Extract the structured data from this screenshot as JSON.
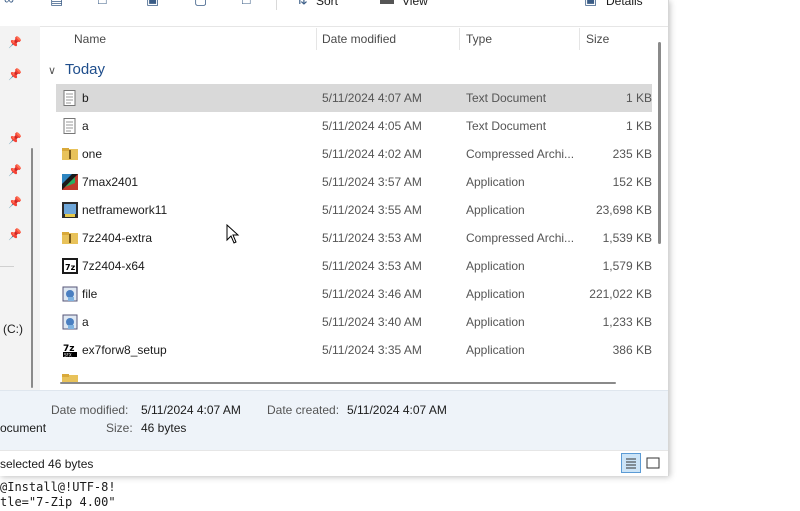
{
  "toolbar": {
    "sort_label": "Sort",
    "view_label": "View",
    "details_label": "Details"
  },
  "nav": {
    "drive_label": "(C:)"
  },
  "columns": {
    "name": "Name",
    "date": "Date modified",
    "type": "Type",
    "size": "Size"
  },
  "group": {
    "label": "Today"
  },
  "files": [
    {
      "name": "b",
      "date": "5/11/2024 4:07 AM",
      "type": "Text Document",
      "size": "1 KB",
      "icon": "text-file-icon",
      "selected": true
    },
    {
      "name": "a",
      "date": "5/11/2024 4:05 AM",
      "type": "Text Document",
      "size": "1 KB",
      "icon": "text-file-icon"
    },
    {
      "name": "one",
      "date": "5/11/2024 4:02 AM",
      "type": "Compressed Archi...",
      "size": "235 KB",
      "icon": "zip-folder-icon"
    },
    {
      "name": "7max2401",
      "date": "5/11/2024 3:57 AM",
      "type": "Application",
      "size": "152 KB",
      "icon": "app-7max-icon"
    },
    {
      "name": "netframework11",
      "date": "5/11/2024 3:55 AM",
      "type": "Application",
      "size": "23,698 KB",
      "icon": "app-installer-icon"
    },
    {
      "name": "7z2404-extra",
      "date": "5/11/2024 3:53 AM",
      "type": "Compressed Archi...",
      "size": "1,539 KB",
      "icon": "zip-folder-icon"
    },
    {
      "name": "7z2404-x64",
      "date": "5/11/2024 3:53 AM",
      "type": "Application",
      "size": "1,579 KB",
      "icon": "app-7zip-icon"
    },
    {
      "name": "file",
      "date": "5/11/2024 3:46 AM",
      "type": "Application",
      "size": "221,022 KB",
      "icon": "app-setup-icon"
    },
    {
      "name": "a",
      "date": "5/11/2024 3:40 AM",
      "type": "Application",
      "size": "1,233 KB",
      "icon": "app-setup-icon"
    },
    {
      "name": "ex7forw8_setup",
      "date": "5/11/2024 3:35 AM",
      "type": "Application",
      "size": "386 KB",
      "icon": "app-7zip-sfx-icon"
    }
  ],
  "details": {
    "date_modified_label": "Date modified:",
    "date_modified_value": "5/11/2024 4:07 AM",
    "date_created_label": "Date created:",
    "date_created_value": "5/11/2024 4:07 AM",
    "type_fragment": "ocument",
    "size_label": "Size:",
    "size_value": "46 bytes"
  },
  "status": {
    "text": "selected  46 bytes"
  },
  "terminal": {
    "line1": "@Install@!UTF-8!",
    "line2": "tle=\"7-Zip 4.00\""
  },
  "colors": {
    "selection": "#d9d9d9",
    "details_bg": "#eef3f9",
    "group_header": "#1f4e8c"
  }
}
